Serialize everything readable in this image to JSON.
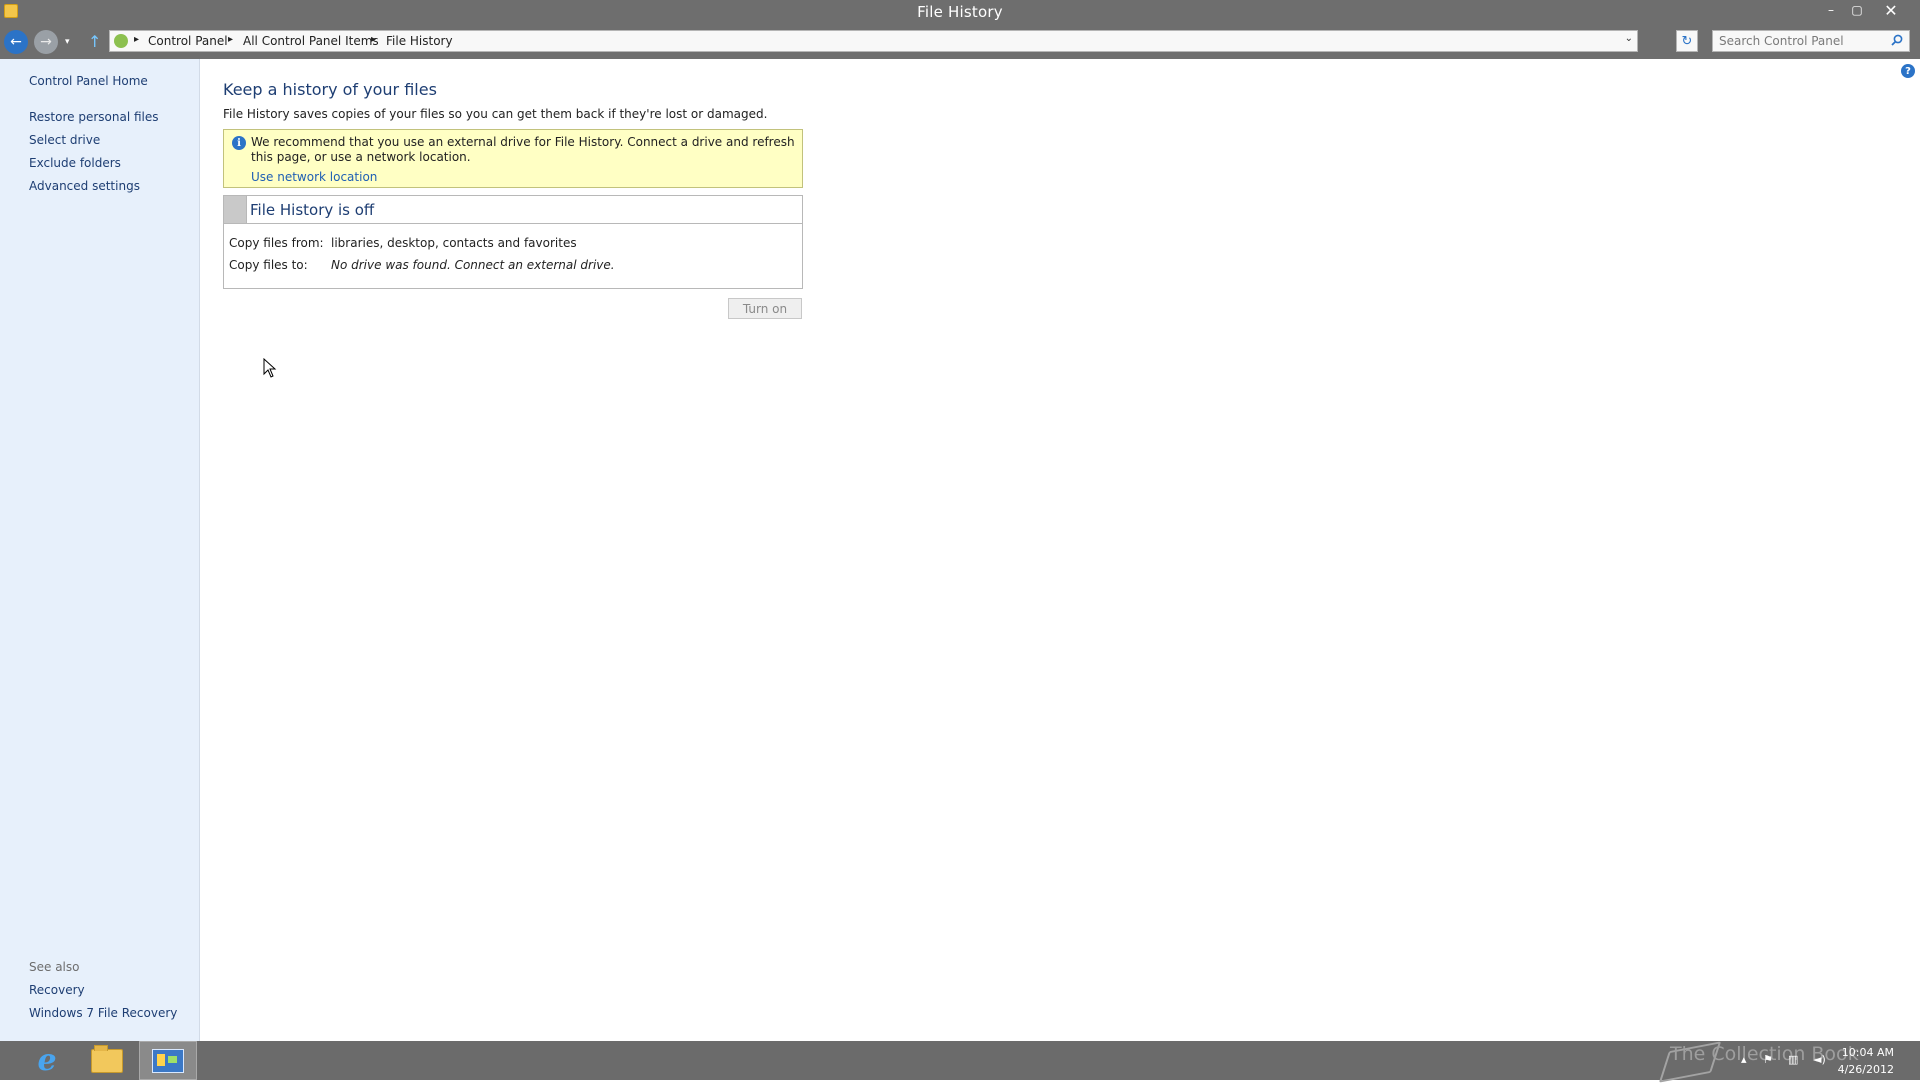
{
  "window": {
    "title": "File History",
    "controls": {
      "minimize": "–",
      "maximize": "▢",
      "close": "✕"
    }
  },
  "navbar": {
    "back_glyph": "←",
    "forward_glyph": "→",
    "recent_glyph": "▾",
    "up_glyph": "↑",
    "breadcrumbs": [
      "Control Panel",
      "All Control Panel Items",
      "File History"
    ],
    "crumb_separator": "▸",
    "dropdown_glyph": "⌄",
    "refresh_glyph": "↻",
    "search": {
      "placeholder": "Search Control Panel",
      "value": "",
      "icon": "search-icon"
    }
  },
  "sidebar": {
    "home": "Control Panel Home",
    "items": [
      "Restore personal files",
      "Select drive",
      "Exclude folders",
      "Advanced settings"
    ],
    "see_also_label": "See also",
    "see_also": [
      "Recovery",
      "Windows 7 File Recovery"
    ]
  },
  "main": {
    "title": "Keep a history of your files",
    "description": "File History saves copies of your files so you can get them back if they're lost or damaged.",
    "info": {
      "icon_text": "i",
      "text": "We recommend that you use an external drive for File History. Connect a drive and refresh this page, or use a network location.",
      "link": "Use network location"
    },
    "status": {
      "title": "File History is off",
      "rows": [
        {
          "label": "Copy files from:",
          "value": "libraries, desktop, contacts and favorites"
        },
        {
          "label": "Copy files to:",
          "value": "No drive was found. Connect an external drive."
        }
      ]
    },
    "turn_on_label": "Turn on",
    "help_glyph": "?"
  },
  "taskbar": {
    "ie_glyph": "e",
    "watermark": "The Collection Book",
    "tray_up": "▴",
    "tray_flag": "⚑",
    "tray_net": "▥",
    "tray_vol": "◄)",
    "time": "10:04 AM",
    "date": "4/26/2012"
  },
  "colors": {
    "chrome": "#6e6e6e",
    "accent": "#2b73c7",
    "link": "#1e3e73",
    "sidebar_bg": "#e7f0fb",
    "info_bg": "#ffffc4"
  }
}
